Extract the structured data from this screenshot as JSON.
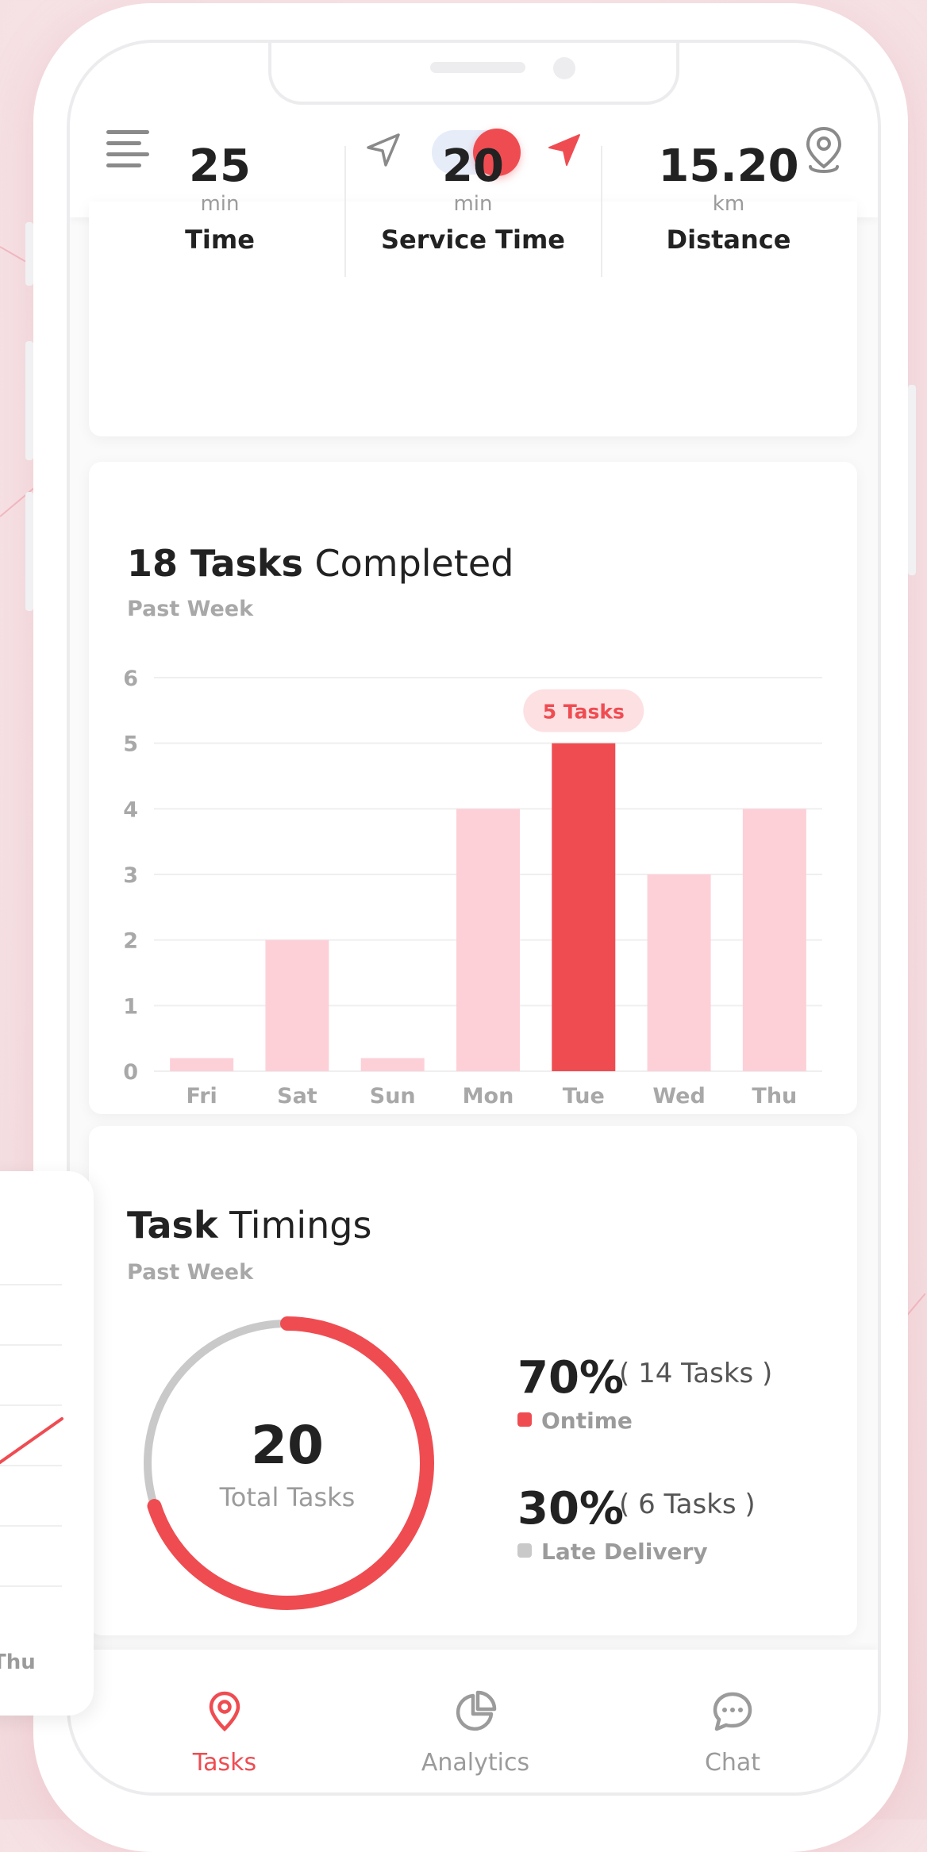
{
  "header": {
    "menu_icon": "menu-icon",
    "nav_icon_off": "navigation-arrow-outline-icon",
    "nav_icon_on": "navigation-arrow-filled-icon",
    "location_icon": "map-pin-icon",
    "toggle_on": true
  },
  "stats": [
    {
      "value": "25",
      "unit": "min",
      "label": "Time"
    },
    {
      "value": "20",
      "unit": "min",
      "label": "Service Time"
    },
    {
      "value": "15.20",
      "unit": "km",
      "label": "Distance"
    }
  ],
  "tasks_card": {
    "title_bold": "18 Tasks",
    "title_rest": "Completed",
    "subtitle": "Past Week",
    "tooltip": "5 Tasks"
  },
  "chart_data": {
    "type": "bar",
    "categories": [
      "Fri",
      "Sat",
      "Sun",
      "Mon",
      "Tue",
      "Wed",
      "Thu"
    ],
    "values": [
      0.2,
      2,
      0.2,
      4,
      5,
      3,
      4
    ],
    "highlight_index": 4,
    "y_ticks": [
      "0",
      "1",
      "2",
      "3",
      "4",
      "5",
      "6"
    ],
    "ylim": [
      0,
      6
    ],
    "grid": true,
    "colors": {
      "bar": "#fdd0d8",
      "highlight": "#ef4c52",
      "tooltip_bg": "#fde0e2",
      "tooltip_text": "#ef4c52"
    }
  },
  "timings_card": {
    "title_bold": "Task",
    "title_rest": "Timings",
    "subtitle": "Past Week",
    "total_value": "20",
    "total_label": "Total Tasks",
    "ontime_fraction": 0.7,
    "ontime_pct": "70%",
    "ontime_note": "( 14 Tasks )",
    "ontime_label": "Ontime",
    "late_pct": "30%",
    "late_note": "( 6 Tasks )",
    "late_label": "Late Delivery",
    "colors": {
      "ontime": "#ef4c52",
      "late": "#c9c9c9"
    }
  },
  "mini_card": {
    "axis_label": "Thu"
  },
  "bottom_nav": [
    {
      "label": "Tasks",
      "icon": "map-pin-icon",
      "active": true
    },
    {
      "label": "Analytics",
      "icon": "pie-chart-icon",
      "active": false
    },
    {
      "label": "Chat",
      "icon": "chat-bubble-icon",
      "active": false
    }
  ],
  "colors": {
    "accent": "#ef4c52",
    "muted": "#9b9b9b",
    "text": "#222222"
  }
}
